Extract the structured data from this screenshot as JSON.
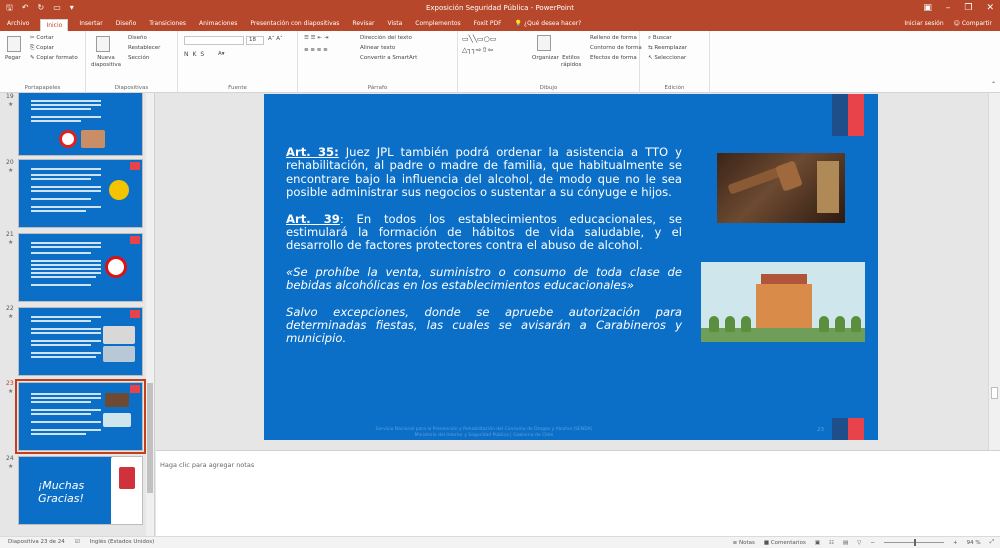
{
  "window": {
    "title": "Exposición Seguridad Pública - PowerPoint",
    "qat_icons": [
      "save-icon",
      "undo-icon",
      "redo-icon",
      "present-icon",
      "customize-icon"
    ],
    "controls": [
      "ribbon-display-icon",
      "minimize-icon",
      "restore-icon",
      "close-icon"
    ]
  },
  "tabs": {
    "items": [
      "Archivo",
      "Inicio",
      "Insertar",
      "Diseño",
      "Transiciones",
      "Animaciones",
      "Presentación con diapositivas",
      "Revisar",
      "Vista",
      "Complementos",
      "Foxit PDF",
      "¿Qué desea hacer?"
    ],
    "active": "Inicio",
    "signin": "Iniciar sesión",
    "share": "Compartir"
  },
  "ribbon": {
    "clipboard": {
      "paste": "Pegar",
      "cut": "Cortar",
      "copy": "Copiar",
      "format": "Copiar formato",
      "label": "Portapapeles"
    },
    "slides": {
      "new": "Nueva diapositiva",
      "layout": "Diseño",
      "reset": "Restablecer",
      "section": "Sección",
      "label": "Diapositivas"
    },
    "font": {
      "size": "18",
      "label": "Fuente"
    },
    "paragraph": {
      "direction": "Dirección del texto",
      "align": "Alinear texto",
      "smartart": "Convertir a SmartArt",
      "label": "Párrafo"
    },
    "drawing": {
      "arrange": "Organizar",
      "styles": "Estilos rápidos",
      "fill": "Relleno de forma",
      "outline": "Contorno de forma",
      "effects": "Efectos de forma",
      "label": "Dibujo"
    },
    "editing": {
      "find": "Buscar",
      "replace": "Reemplazar",
      "select": "Seleccionar",
      "label": "Edición"
    }
  },
  "thumbnails": [
    {
      "num": "19"
    },
    {
      "num": "20"
    },
    {
      "num": "21"
    },
    {
      "num": "22"
    },
    {
      "num": "23"
    },
    {
      "num": "24",
      "title": "¡Muchas Gracias!"
    }
  ],
  "slide": {
    "p1_art": "Art. 35:",
    "p1_text": " Juez JPL también podrá ordenar la asistencia a TTO y rehabilitación, al padre o madre de familia, que habitualmente se encontrare bajo la influencia del alcohol, de modo que no le sea posible administrar sus negocios o sustentar a su cónyuge e hijos.",
    "p2_art": "Art. 39",
    "p2_text": ": En todos los establecimientos educacionales, se estimulará la formación de hábitos de vida saludable, y el desarrollo de factores protectores contra el abuso de alcohol.",
    "p3": "«Se prohíbe la venta, suministro o consumo de toda clase de bebidas alcohólicas en los establecimientos educacionales»",
    "p4": "Salvo excepciones, donde se apruebe autorización para determinadas fiestas, las cuales se avisarán a Carabineros y municipio.",
    "footer1": "Servicio Nacional para la Prevención y Rehabilitación del Consumo de Drogas y Alcohol (SENDA)",
    "footer2": "Ministerio del Interior y Seguridad Pública | Gobierno de Chile",
    "page": "23"
  },
  "notes": {
    "placeholder": "Haga clic para agregar notas"
  },
  "status": {
    "slide_info": "Diapositiva 23 de 24",
    "language": "Inglés (Estados Unidos)",
    "notes": "Notas",
    "comments": "Comentarios",
    "zoom": "94 %"
  },
  "colors": {
    "accent": "#b7472a",
    "slide_bg": "#0c6fc7",
    "slide_red": "#e8434a",
    "slide_navy": "#1e4f8a"
  }
}
